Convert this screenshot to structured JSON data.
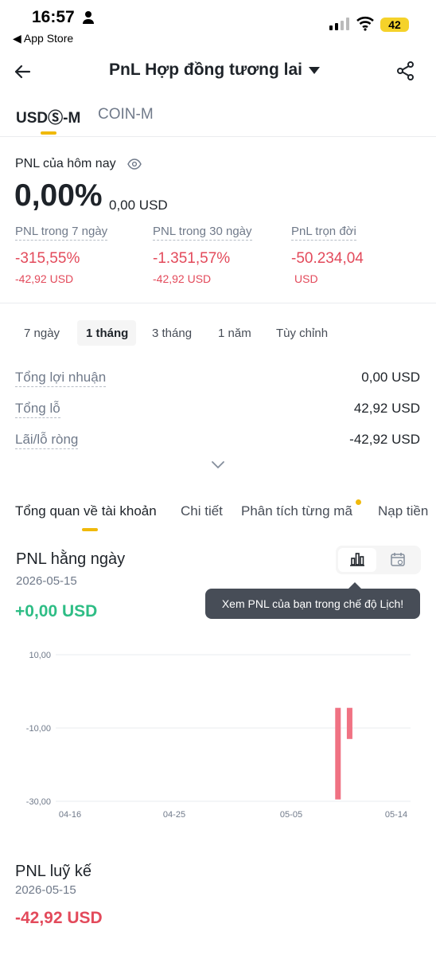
{
  "status": {
    "time": "16:57",
    "back_app": "App Store",
    "battery": "42"
  },
  "header": {
    "title": "PnL Hợp đồng tương lai"
  },
  "tabs": [
    {
      "label": "USDⓈ-M"
    },
    {
      "label": "COIN-M"
    }
  ],
  "today": {
    "label": "PNL của hôm nay",
    "percent": "0,00%",
    "usd": "0,00 USD"
  },
  "stats": [
    {
      "label": "PNL trong 7 ngày",
      "value": "-315,55%",
      "sub": "-42,92 USD"
    },
    {
      "label": "PNL trong 30 ngày",
      "value": "-1.351,57%",
      "sub": "-42,92 USD"
    },
    {
      "label": "PnL trọn đời",
      "value": "-50.234,04",
      "sub": "USD"
    }
  ],
  "periods": [
    "7 ngày",
    "1 tháng",
    "3 tháng",
    "1 năm",
    "Tùy chỉnh"
  ],
  "summary": [
    {
      "label": "Tổng lợi nhuận",
      "value": "0,00 USD"
    },
    {
      "label": "Tổng lỗ",
      "value": "42,92 USD"
    },
    {
      "label": "Lãi/lỗ ròng",
      "value": "-42,92 USD"
    }
  ],
  "section_tabs": [
    "Tổng quan về tài khoản",
    "Chi tiết",
    "Phân tích từng mã",
    "Nạp tiền"
  ],
  "daily": {
    "title": "PNL hằng ngày",
    "date": "2026-05-15",
    "value": "+0,00 USD",
    "tooltip": "Xem PNL của bạn trong chế độ Lịch!"
  },
  "cumulative": {
    "title": "PNL luỹ kế",
    "date": "2026-05-15",
    "value": "-42,92 USD"
  },
  "chart_data": {
    "type": "bar",
    "x": [
      "05-09",
      "05-10"
    ],
    "values": [
      -29.5,
      -13.0
    ],
    "xticks": [
      "04-16",
      "04-25",
      "05-05",
      "05-14"
    ],
    "yticks": [
      "10,00",
      "-10,00",
      "-30,00"
    ],
    "ylim": [
      -30,
      10
    ],
    "bar_color": "#f07283",
    "grid": true
  },
  "colors": {
    "accent": "#f0b90b",
    "negative": "#e34a5b",
    "positive": "#2ebd85"
  }
}
